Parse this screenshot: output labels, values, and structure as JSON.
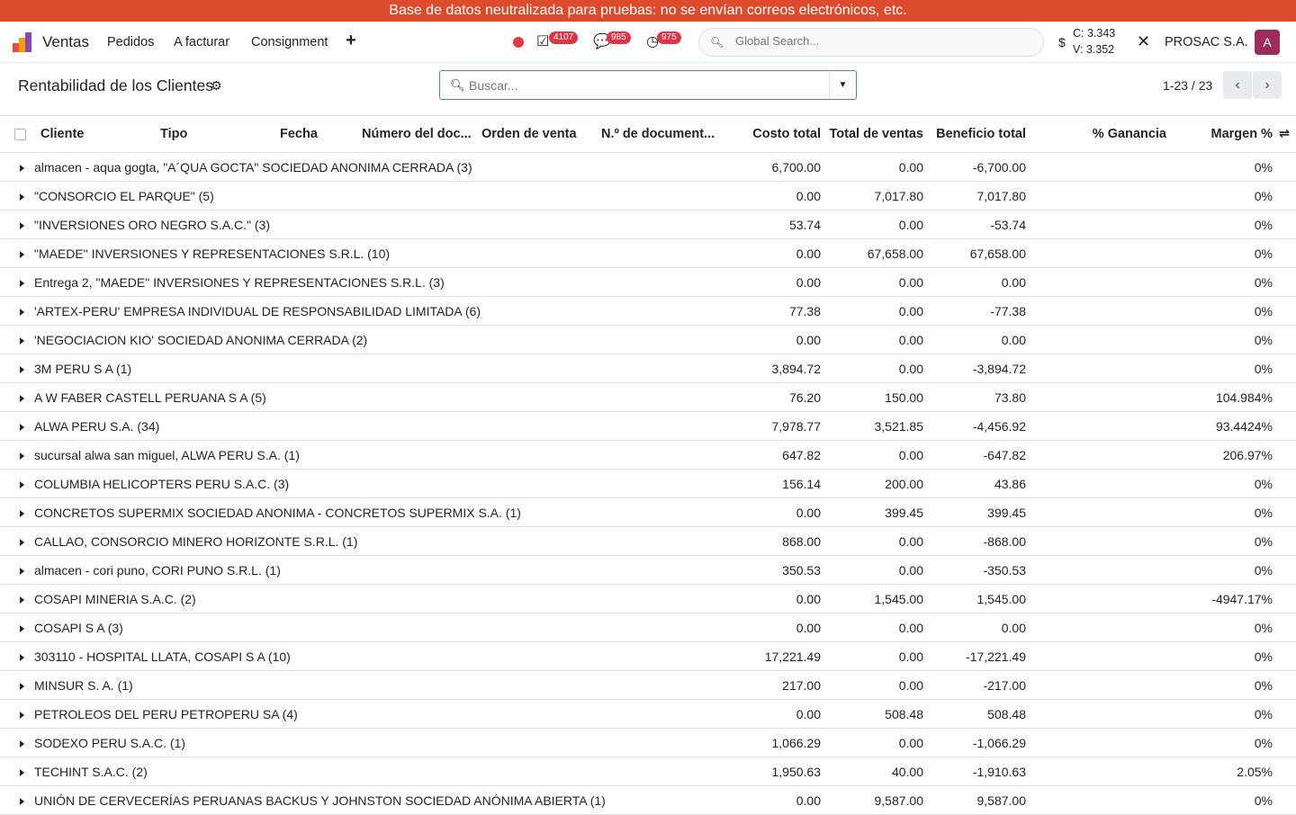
{
  "banner": "Base de datos neutralizada para pruebas: no se envían correos electrónicos, etc.",
  "navbar": {
    "brand": "Ventas",
    "menu": [
      "Pedidos",
      "A facturar",
      "Consignment"
    ],
    "badges": {
      "activities": "4107",
      "messages": "985",
      "clock": "975"
    },
    "global_search_placeholder": "Global Search...",
    "rate_c": "C: 3.343",
    "rate_v": "V: 3.352",
    "company": "PROSAC S.A.",
    "avatar": "A"
  },
  "control": {
    "title": "Rentabilidad de los Clientes",
    "search_placeholder": "Buscar...",
    "pager": "1-23 / 23"
  },
  "table": {
    "headers": [
      "Cliente",
      "Tipo",
      "Fecha",
      "Número del doc...",
      "Orden de venta",
      "N.º de document...",
      "Costo total",
      "Total de ventas",
      "Beneficio total",
      "% Ganancia",
      "Margen %"
    ],
    "rows": [
      [
        "almacen - aqua gogta, \"A´QUA GOCTA\" SOCIEDAD ANONIMA CERRADA (3)",
        "6,700.00",
        "0.00",
        "-6,700.00",
        "0%"
      ],
      [
        "\"CONSORCIO EL PARQUE\" (5)",
        "0.00",
        "7,017.80",
        "7,017.80",
        "0%"
      ],
      [
        "\"INVERSIONES ORO NEGRO S.A.C.\" (3)",
        "53.74",
        "0.00",
        "-53.74",
        "0%"
      ],
      [
        "\"MAEDE\" INVERSIONES Y REPRESENTACIONES S.R.L. (10)",
        "0.00",
        "67,658.00",
        "67,658.00",
        "0%"
      ],
      [
        "Entrega 2, \"MAEDE\" INVERSIONES Y REPRESENTACIONES S.R.L. (3)",
        "0.00",
        "0.00",
        "0.00",
        "0%"
      ],
      [
        "'ARTEX-PERU' EMPRESA INDIVIDUAL DE RESPONSABILIDAD LIMITADA (6)",
        "77.38",
        "0.00",
        "-77.38",
        "0%"
      ],
      [
        "'NEGOCIACION KIO' SOCIEDAD ANONIMA CERRADA (2)",
        "0.00",
        "0.00",
        "0.00",
        "0%"
      ],
      [
        "3M PERU S A (1)",
        "3,894.72",
        "0.00",
        "-3,894.72",
        "0%"
      ],
      [
        "A W FABER CASTELL PERUANA S A (5)",
        "76.20",
        "150.00",
        "73.80",
        "104.984%"
      ],
      [
        "ALWA PERU S.A. (34)",
        "7,978.77",
        "3,521.85",
        "-4,456.92",
        "93.4424%"
      ],
      [
        "sucursal alwa san miguel, ALWA PERU S.A. (1)",
        "647.82",
        "0.00",
        "-647.82",
        "206.97%"
      ],
      [
        "COLUMBIA HELICOPTERS PERU S.A.C. (3)",
        "156.14",
        "200.00",
        "43.86",
        "0%"
      ],
      [
        "CONCRETOS SUPERMIX SOCIEDAD ANONIMA - CONCRETOS SUPERMIX S.A. (1)",
        "0.00",
        "399.45",
        "399.45",
        "0%"
      ],
      [
        "CALLAO, CONSORCIO MINERO HORIZONTE S.R.L. (1)",
        "868.00",
        "0.00",
        "-868.00",
        "0%"
      ],
      [
        "almacen - cori puno, CORI PUNO S.R.L. (1)",
        "350.53",
        "0.00",
        "-350.53",
        "0%"
      ],
      [
        "COSAPI MINERIA S.A.C. (2)",
        "0.00",
        "1,545.00",
        "1,545.00",
        "-4947.17%"
      ],
      [
        "COSAPI S A (3)",
        "0.00",
        "0.00",
        "0.00",
        "0%"
      ],
      [
        "303110 - HOSPITAL LLATA, COSAPI S A (10)",
        "17,221.49",
        "0.00",
        "-17,221.49",
        "0%"
      ],
      [
        "MINSUR S. A. (1)",
        "217.00",
        "0.00",
        "-217.00",
        "0%"
      ],
      [
        "PETROLEOS DEL PERU PETROPERU SA (4)",
        "0.00",
        "508.48",
        "508.48",
        "0%"
      ],
      [
        "SODEXO PERU S.A.C. (1)",
        "1,066.29",
        "0.00",
        "-1,066.29",
        "0%"
      ],
      [
        "TECHINT S.A.C. (2)",
        "1,950.63",
        "40.00",
        "-1,910.63",
        "2.05%"
      ],
      [
        "UNIÓN DE CERVECERÍAS PERUANAS BACKUS Y JOHNSTON SOCIEDAD ANÓNIMA ABIERTA (1)",
        "0.00",
        "9,587.00",
        "9,587.00",
        "0%"
      ]
    ]
  }
}
